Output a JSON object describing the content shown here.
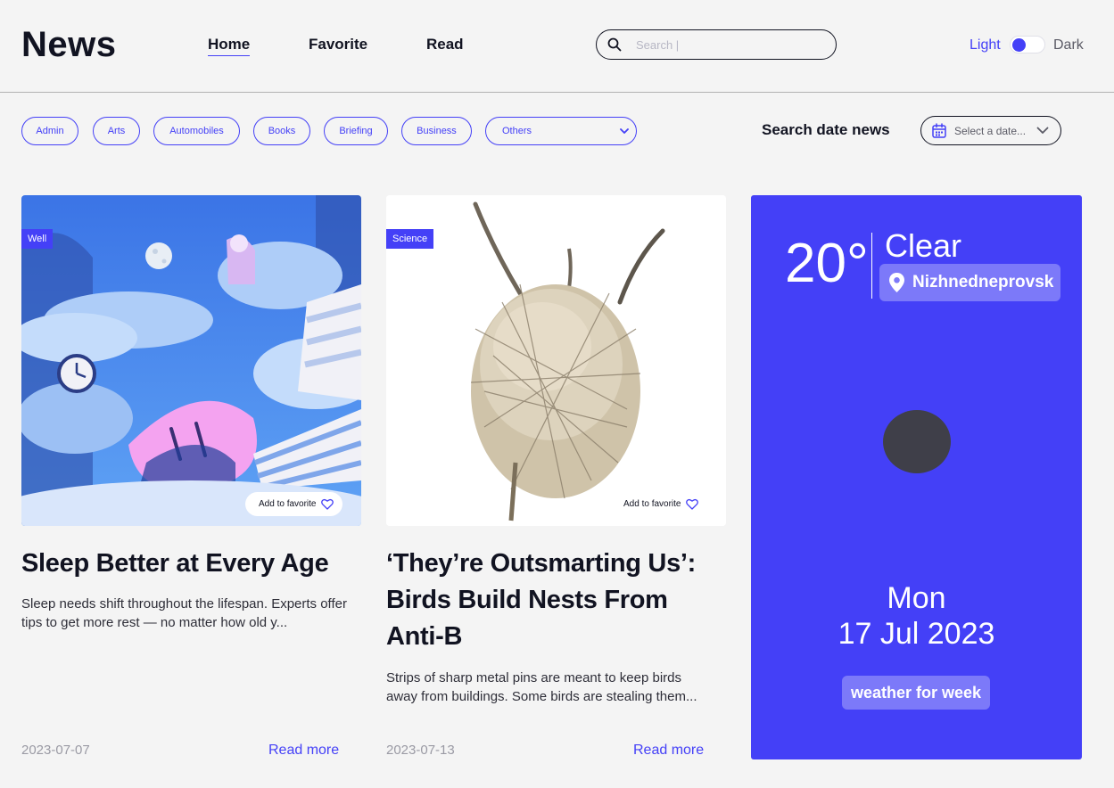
{
  "header": {
    "logo": "News",
    "nav": [
      {
        "label": "Home",
        "active": true
      },
      {
        "label": "Favorite",
        "active": false
      },
      {
        "label": "Read",
        "active": false
      }
    ],
    "search_placeholder": "Search |",
    "search_icon": "search-icon",
    "theme": {
      "light_label": "Light",
      "dark_label": "Dark",
      "mode": "light"
    }
  },
  "filters": {
    "categories": [
      "Admin",
      "Arts",
      "Automobiles",
      "Books",
      "Briefing",
      "Business"
    ],
    "others_label": "Others",
    "date_label": "Search date news",
    "date_placeholder": "Select a date..."
  },
  "cards": [
    {
      "tag": "Well",
      "image_icon": "sleep-illustration",
      "favorite_label": "Add to favorite",
      "title": "Sleep Better at Every Age",
      "description": "Sleep needs shift throughout the lifespan. Experts offer tips to get more rest — no matter how old y...",
      "date": "2023-07-07",
      "read_more": "Read more"
    },
    {
      "tag": "Science",
      "image_icon": "bird-nest-photo",
      "favorite_label": "Add to favorite",
      "title": "‘They’re Outsmarting Us’: Birds Build Nests From Anti-B",
      "description": "Strips of sharp metal pins are meant to keep birds away from buildings. Some birds are stealing them...",
      "date": "2023-07-13",
      "read_more": "Read more"
    }
  ],
  "weather": {
    "temperature": "20°",
    "condition": "Clear",
    "location": "Nizhnedneprovsk",
    "day": "Mon",
    "date": "17 Jul 2023",
    "week_button": "weather for week"
  },
  "colors": {
    "accent": "#4440f7",
    "background": "#f4f4f4",
    "text": "#111321",
    "muted": "#9a9aa4"
  }
}
